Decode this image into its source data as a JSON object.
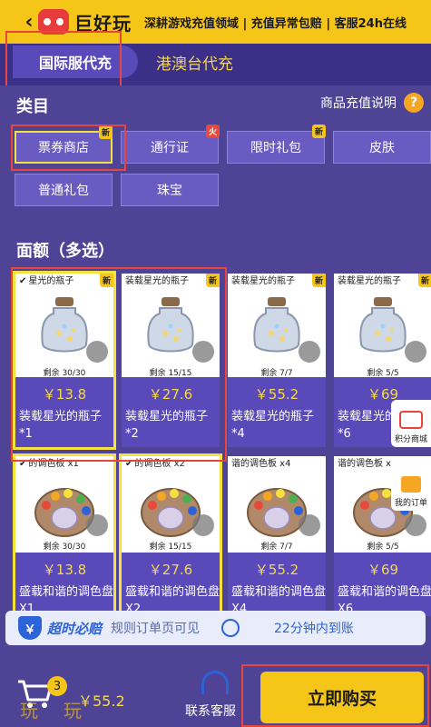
{
  "header": {
    "logo_text": "巨好玩",
    "marquee": "深耕游戏充值领域 | 充值异常包赔 | 客服24h在线"
  },
  "region_tabs": {
    "active": "国际服代充",
    "other": "港澳台代充"
  },
  "category": {
    "title": "类目",
    "help_label": "商品充值说明",
    "help_icon_text": "?",
    "items": [
      {
        "label": "票券商店",
        "badge": "新"
      },
      {
        "label": "通行证",
        "badge": "火"
      },
      {
        "label": "限时礼包",
        "badge": "新"
      },
      {
        "label": "皮肤",
        "badge": ""
      },
      {
        "label": "普通礼包",
        "badge": ""
      },
      {
        "label": "珠宝",
        "badge": ""
      }
    ]
  },
  "denomination": {
    "title": "面额（多选）",
    "cards": [
      {
        "name": "星光的瓶子",
        "badge": "新",
        "checked": true,
        "remain": "剩余 30/30",
        "price": "￥13.8",
        "title": "装载星光的瓶子*1"
      },
      {
        "name": "装载星光的瓶子",
        "badge": "新",
        "checked": false,
        "remain": "剩余 15/15",
        "price": "￥27.6",
        "title": "装载星光的瓶子*2"
      },
      {
        "name": "装载星光的瓶子",
        "badge": "新",
        "checked": false,
        "remain": "剩余 7/7",
        "price": "￥55.2",
        "title": "装载星光的瓶子*4"
      },
      {
        "name": "装载星光的瓶子",
        "badge": "新",
        "checked": false,
        "remain": "剩余 5/5",
        "price": "￥69",
        "title": "装载星光的瓶子*6"
      },
      {
        "name": "的调色板 x1",
        "badge": "",
        "checked": true,
        "remain": "剩余 30/30",
        "price": "￥13.8",
        "title": "盛载和谐的调色盘X1"
      },
      {
        "name": "的调色板 x2",
        "badge": "",
        "checked": true,
        "remain": "剩余 15/15",
        "price": "￥27.6",
        "title": "盛载和谐的调色盘X2"
      },
      {
        "name": "谐的调色板 x4",
        "badge": "",
        "checked": false,
        "remain": "剩余 7/7",
        "price": "￥55.2",
        "title": "盛载和谐的调色盘X4"
      },
      {
        "name": "谐的调色板 x",
        "badge": "",
        "checked": false,
        "remain": "剩余 5/5",
        "price": "￥69",
        "title": "盛载和谐的调色盘X6"
      }
    ]
  },
  "float": {
    "points_mall": "积分商城",
    "my_orders": "我的订单"
  },
  "guarantee": {
    "icon_text": "￥",
    "title": "超时必赔",
    "subtitle": "规则订单页可见",
    "time": "22分钟内到账"
  },
  "bottom": {
    "cart_count": "3",
    "total": "￥55.2",
    "contact": "联系客服",
    "buy": "立即购买",
    "watermark": "玩玩"
  },
  "colors": {
    "accent_yellow": "#f5c518",
    "panel_purple": "#4f4396",
    "highlight_red": "#e8453c",
    "price_yellow": "#f6d84a"
  }
}
